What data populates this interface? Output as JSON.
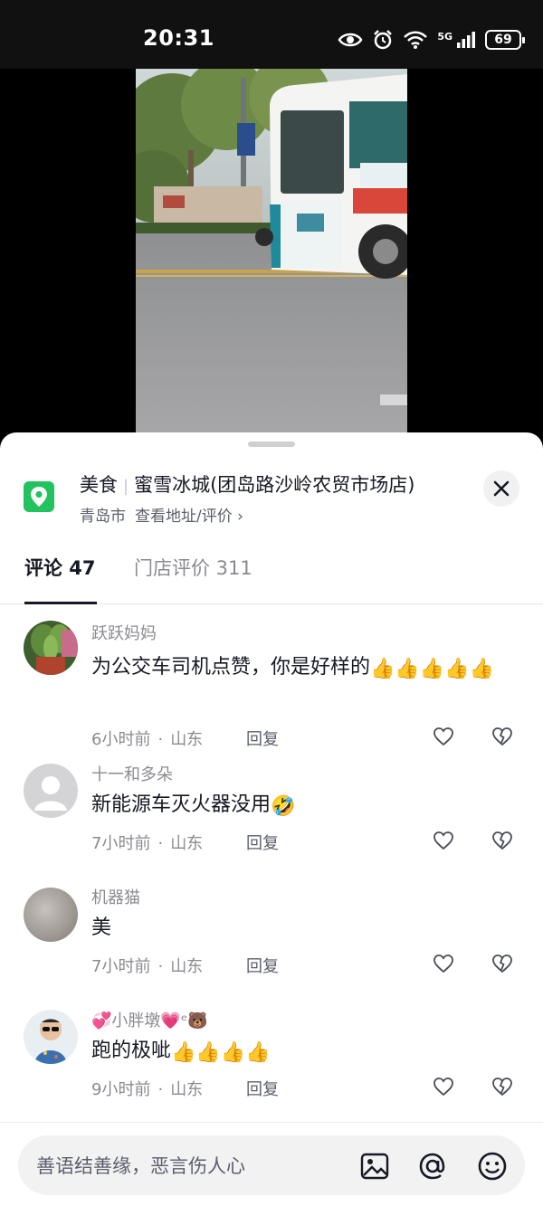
{
  "status": {
    "time": "20:31",
    "network": "5G",
    "battery": "69"
  },
  "icons": {
    "status": [
      "eye-icon",
      "alarm-icon",
      "wifi-icon",
      "signal-icon",
      "battery-icon"
    ],
    "poi": "location-pin-icon",
    "close": "close-icon",
    "like": "heart-outline-icon",
    "dislike": "broken-heart-icon",
    "input": [
      "image-icon",
      "at-icon",
      "emoji-icon"
    ]
  },
  "poi": {
    "category": "美食",
    "name": "蜜雪冰城(团岛路沙岭农贸市场店)",
    "city": "青岛市",
    "link": "查看地址/评价 ›"
  },
  "tabs": {
    "comments": "评论 47",
    "reviews": "门店评价 311"
  },
  "comments": [
    {
      "user": "跃跃妈妈",
      "text": "为公交车司机点赞，你是好样的",
      "emojis": "👍👍👍👍👍",
      "time": "6小时前",
      "region": "山东",
      "reply": "回复"
    },
    {
      "user": "十一和多朵",
      "text": "新能源车灭火器没用",
      "emojis": "🤣",
      "time": "7小时前",
      "region": "山东",
      "reply": "回复"
    },
    {
      "user": "机器猫",
      "text": "美",
      "emojis": "",
      "time": "7小时前",
      "region": "山东",
      "reply": "回复"
    },
    {
      "user": "小胖墩",
      "user_prefix": "💞",
      "user_suffix": "💗ᵉ🐻",
      "text": "跑的极呲",
      "emojis": "👍👍👍👍",
      "time": "9小时前",
      "region": "山东",
      "reply": "回复"
    }
  ],
  "meta_separator": "·",
  "input": {
    "placeholder": "善语结善缘，恶言伤人心"
  },
  "colors": {
    "poi_green": "#22c35e",
    "text_primary": "#161823",
    "text_secondary": "#8a8b91"
  }
}
